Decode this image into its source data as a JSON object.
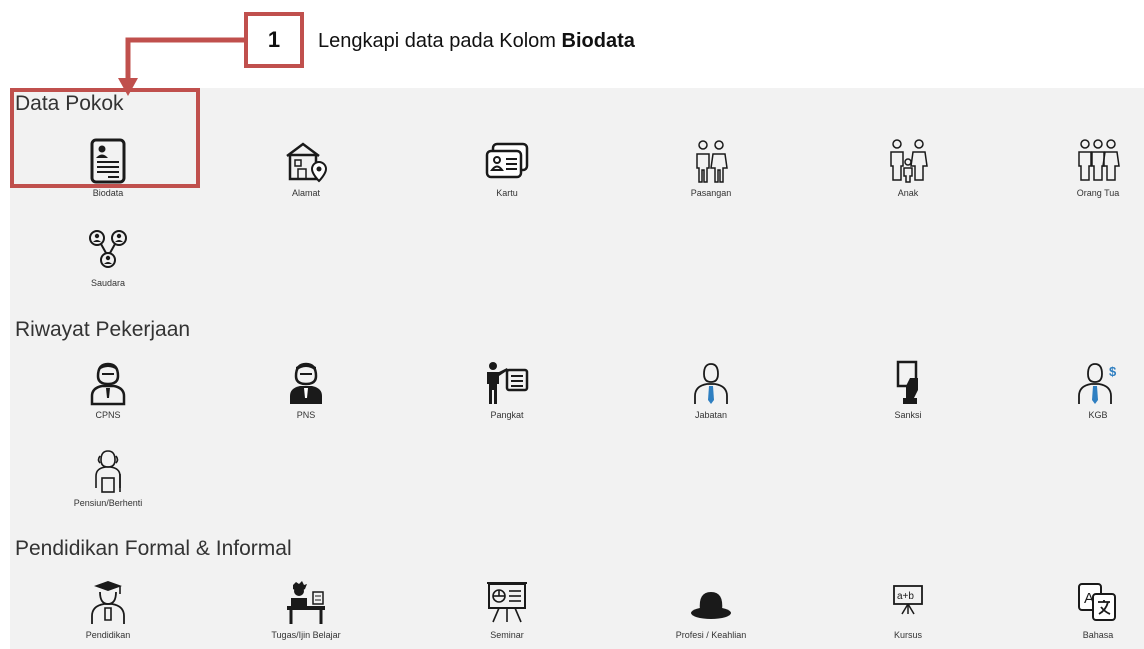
{
  "callout": {
    "number": "1",
    "text_prefix": "Lengkapi data pada Kolom ",
    "text_bold": "Biodata"
  },
  "sections": {
    "data_pokok": {
      "title": "Data Pokok",
      "items": [
        "Biodata",
        "Alamat",
        "Kartu",
        "Pasangan",
        "Anak",
        "Orang Tua",
        "Saudara"
      ]
    },
    "riwayat_pekerjaan": {
      "title": "Riwayat Pekerjaan",
      "items": [
        "CPNS",
        "PNS",
        "Pangkat",
        "Jabatan",
        "Sanksi",
        "KGB",
        "Pensiun/Berhenti"
      ]
    },
    "pendidikan": {
      "title": "Pendidikan Formal & Informal",
      "items": [
        "Pendidikan",
        "Tugas/Ijin Belajar",
        "Seminar",
        "Profesi / Keahlian",
        "Kursus",
        "Bahasa"
      ]
    }
  },
  "colors": {
    "callout_red": "#c0504d",
    "panel_bg": "#f2f2f2",
    "icon_dark": "#1a1a1a",
    "accent_blue": "#2f7fc1"
  }
}
